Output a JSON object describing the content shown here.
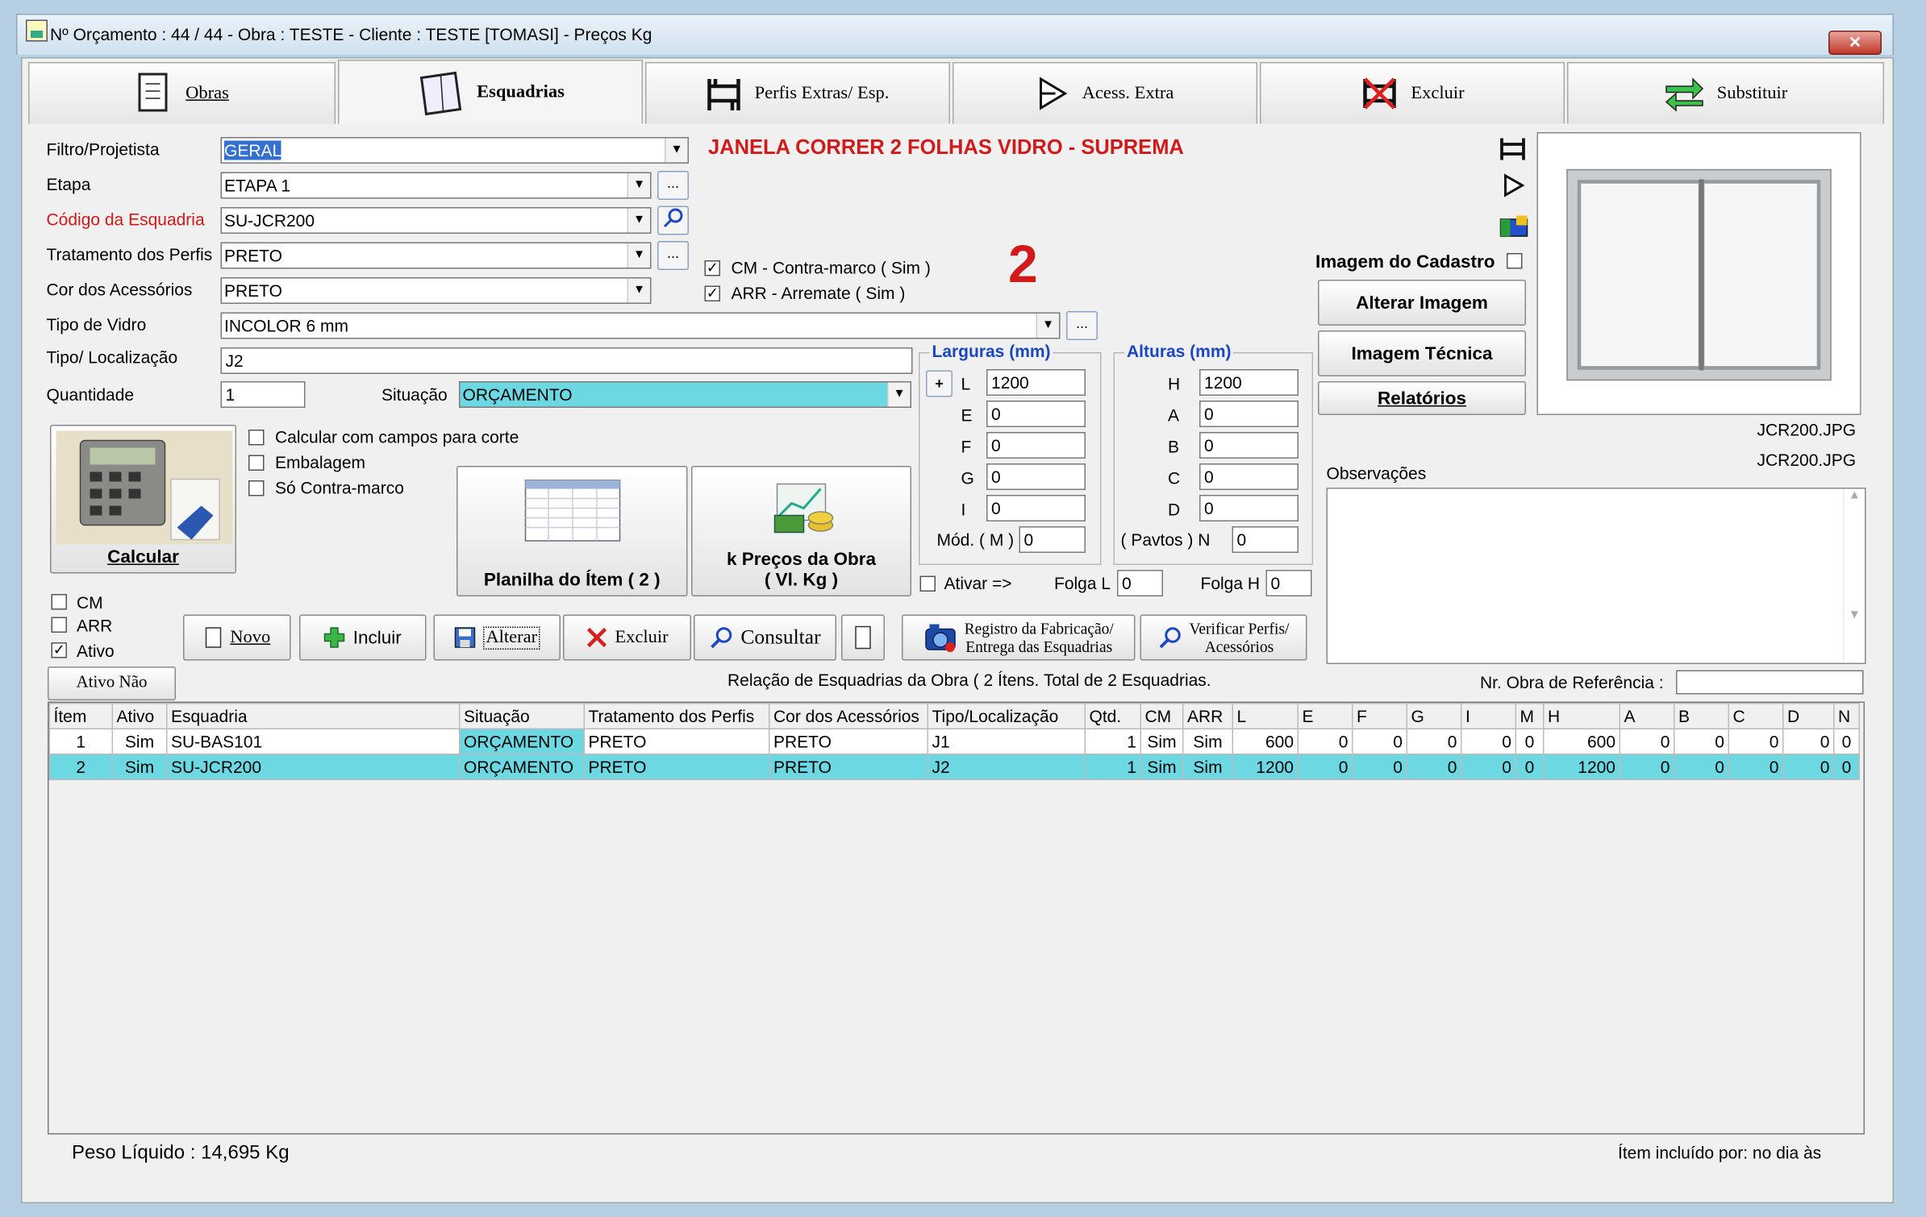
{
  "window": {
    "title": "Nº Orçamento : 44 / 44 - Obra : TESTE - Cliente : TESTE [TOMASI] - Preços Kg",
    "close": "✕"
  },
  "tabs": [
    {
      "label": "Obras",
      "icon": "document-icon"
    },
    {
      "label": "Esquadrias",
      "icon": "window-icon",
      "selected": true
    },
    {
      "label": "Perfis  Extras/ Esp.",
      "icon": "profile-icon"
    },
    {
      "label": "Acess. Extra",
      "icon": "accessory-icon"
    },
    {
      "label": "Excluir",
      "icon": "delete-icon"
    },
    {
      "label": "Substituir",
      "icon": "swap-icon"
    }
  ],
  "form": {
    "filtro_label": "Filtro/Projetista",
    "filtro_value": "GERAL",
    "etapa_label": "Etapa",
    "etapa_value": "ETAPA 1",
    "codigo_label": "Código da Esquadria",
    "codigo_value": "SU-JCR200",
    "tratamento_label": "Tratamento dos Perfis",
    "tratamento_value": "PRETO",
    "cor_label": "Cor dos Acessórios",
    "cor_value": "PRETO",
    "vidro_label": "Tipo de Vidro",
    "vidro_value": "INCOLOR 6 mm",
    "tipo_loc_label": "Tipo/ Localização",
    "tipo_loc_value": "J2",
    "qtd_label": "Quantidade",
    "qtd_value": "1",
    "situacao_label": "Situação",
    "situacao_value": "ORÇAMENTO",
    "ellipsis": "...",
    "product_title": "JANELA CORRER 2 FOLHAS VIDRO - SUPREMA",
    "big_number": "2",
    "cm_label": "CM - Contra-marco ( Sim )",
    "arr_label": "ARR - Arremate ( Sim )"
  },
  "calc": {
    "button": "Calcular",
    "opt1": "Calcular com campos para corte",
    "opt2": "Embalagem",
    "opt3": "Só Contra-marco",
    "planilha": "Planilha do Ítem ( 2 )",
    "precos1": "k Preços da Obra",
    "precos2": "( Vl. Kg )"
  },
  "larguras": {
    "title": "Larguras (mm)",
    "plus": "+",
    "L": "1200",
    "E": "0",
    "F": "0",
    "G": "0",
    "I": "0",
    "mod_label": "Mód. ( M )",
    "mod_value": "0",
    "ativar_label": "Ativar =>",
    "folga_l_label": "Folga L",
    "folga_l": "0"
  },
  "alturas": {
    "title": "Alturas (mm)",
    "H": "1200",
    "A": "0",
    "B": "0",
    "C": "0",
    "D": "0",
    "pavtos_label": "( Pavtos ) N",
    "pavtos_value": "0",
    "folga_h_label": "Folga H",
    "folga_h": "0"
  },
  "right": {
    "imagem_cadastro": "Imagem do Cadastro",
    "alterar": "Alterar Imagem",
    "tecnica": "Imagem Técnica",
    "relatorios": "Relatórios",
    "file1": "JCR200.JPG",
    "file2": "JCR200.JPG",
    "obs_label": "Observações"
  },
  "filters": {
    "cm": "CM",
    "arr": "ARR",
    "ativo": "Ativo"
  },
  "toolbar": {
    "novo": "Novo",
    "incluir": "Incluir",
    "alterar": "Alterar",
    "excluir": "Excluir",
    "consultar": "Consultar",
    "registro1": "Registro da Fabricação/",
    "registro2": "Entrega das Esquadrias",
    "verificar1": "Verificar Perfis/",
    "verificar2": "Acessórios"
  },
  "list": {
    "ativo_nao": "Ativo Não",
    "caption": "Relação de Esquadrias da Obra ( 2 Ítens. Total de 2 Esquadrias.",
    "nr_obra_label": "Nr. Obra de Referência :",
    "headers": [
      "Ítem",
      "Ativo",
      "Esquadria",
      "Situação",
      "Tratamento dos Perfis",
      "Cor dos Acessórios",
      "Tipo/Localização",
      "Qtd.",
      "CM",
      "ARR",
      "L",
      "E",
      "F",
      "G",
      "I",
      "M",
      "H",
      "A",
      "B",
      "C",
      "D",
      "N"
    ],
    "rows": [
      [
        "1",
        "Sim",
        "SU-BAS101",
        "ORÇAMENTO",
        "PRETO",
        "PRETO",
        "J1",
        "1",
        "Sim",
        "Sim",
        "600",
        "0",
        "0",
        "0",
        "0",
        "0",
        "600",
        "0",
        "0",
        "0",
        "0",
        "0"
      ],
      [
        "2",
        "Sim",
        "SU-JCR200",
        "ORÇAMENTO",
        "PRETO",
        "PRETO",
        "J2",
        "1",
        "Sim",
        "Sim",
        "1200",
        "0",
        "0",
        "0",
        "0",
        "0",
        "1200",
        "0",
        "0",
        "0",
        "0",
        "0"
      ]
    ]
  },
  "footer": {
    "peso": "Peso Líquido : 14,695 Kg",
    "incluido": "Ítem incluído por:  no dia  às"
  },
  "colors": {
    "accent_cyan": "#6cd8e2",
    "title_red": "#d21a1a",
    "group_blue": "#1a47c4"
  }
}
